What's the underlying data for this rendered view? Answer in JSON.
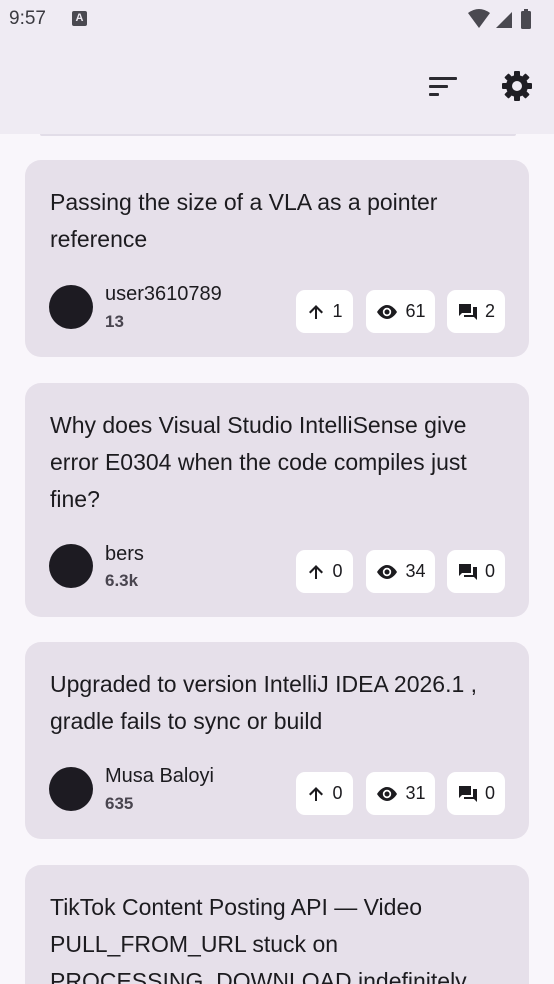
{
  "status_bar": {
    "time": "9:57",
    "notification_icon": "A",
    "icons": [
      "wifi-icon",
      "signal-icon",
      "battery-icon"
    ]
  },
  "toolbar": {
    "sort_icon": "sort-icon",
    "settings_icon": "gear-icon"
  },
  "questions": [
    {
      "title": "Passing the size of a VLA as a pointer reference",
      "author": "user3610789",
      "reputation": "13",
      "votes": "1",
      "views": "61",
      "answers": "2"
    },
    {
      "title": "Why does Visual Studio IntelliSense give error E0304 when the code compiles just fine?",
      "author": "bers",
      "reputation": "6.3k",
      "votes": "0",
      "views": "34",
      "answers": "0"
    },
    {
      "title": "Upgraded to version IntelliJ IDEA 2026.1 , gradle fails to sync or build",
      "author": "Musa Baloyi",
      "reputation": "635",
      "votes": "0",
      "views": "31",
      "answers": "0"
    },
    {
      "title": "TikTok Content Posting API — Video PULL_FROM_URL stuck on PROCESSING_DOWNLOAD indefinitely"
    }
  ],
  "colors": {
    "background": "#f9f6fb",
    "card": "#e6e0ea",
    "bar": "#efebf3",
    "chip": "#ffffff",
    "avatar": "#1d1b22"
  }
}
